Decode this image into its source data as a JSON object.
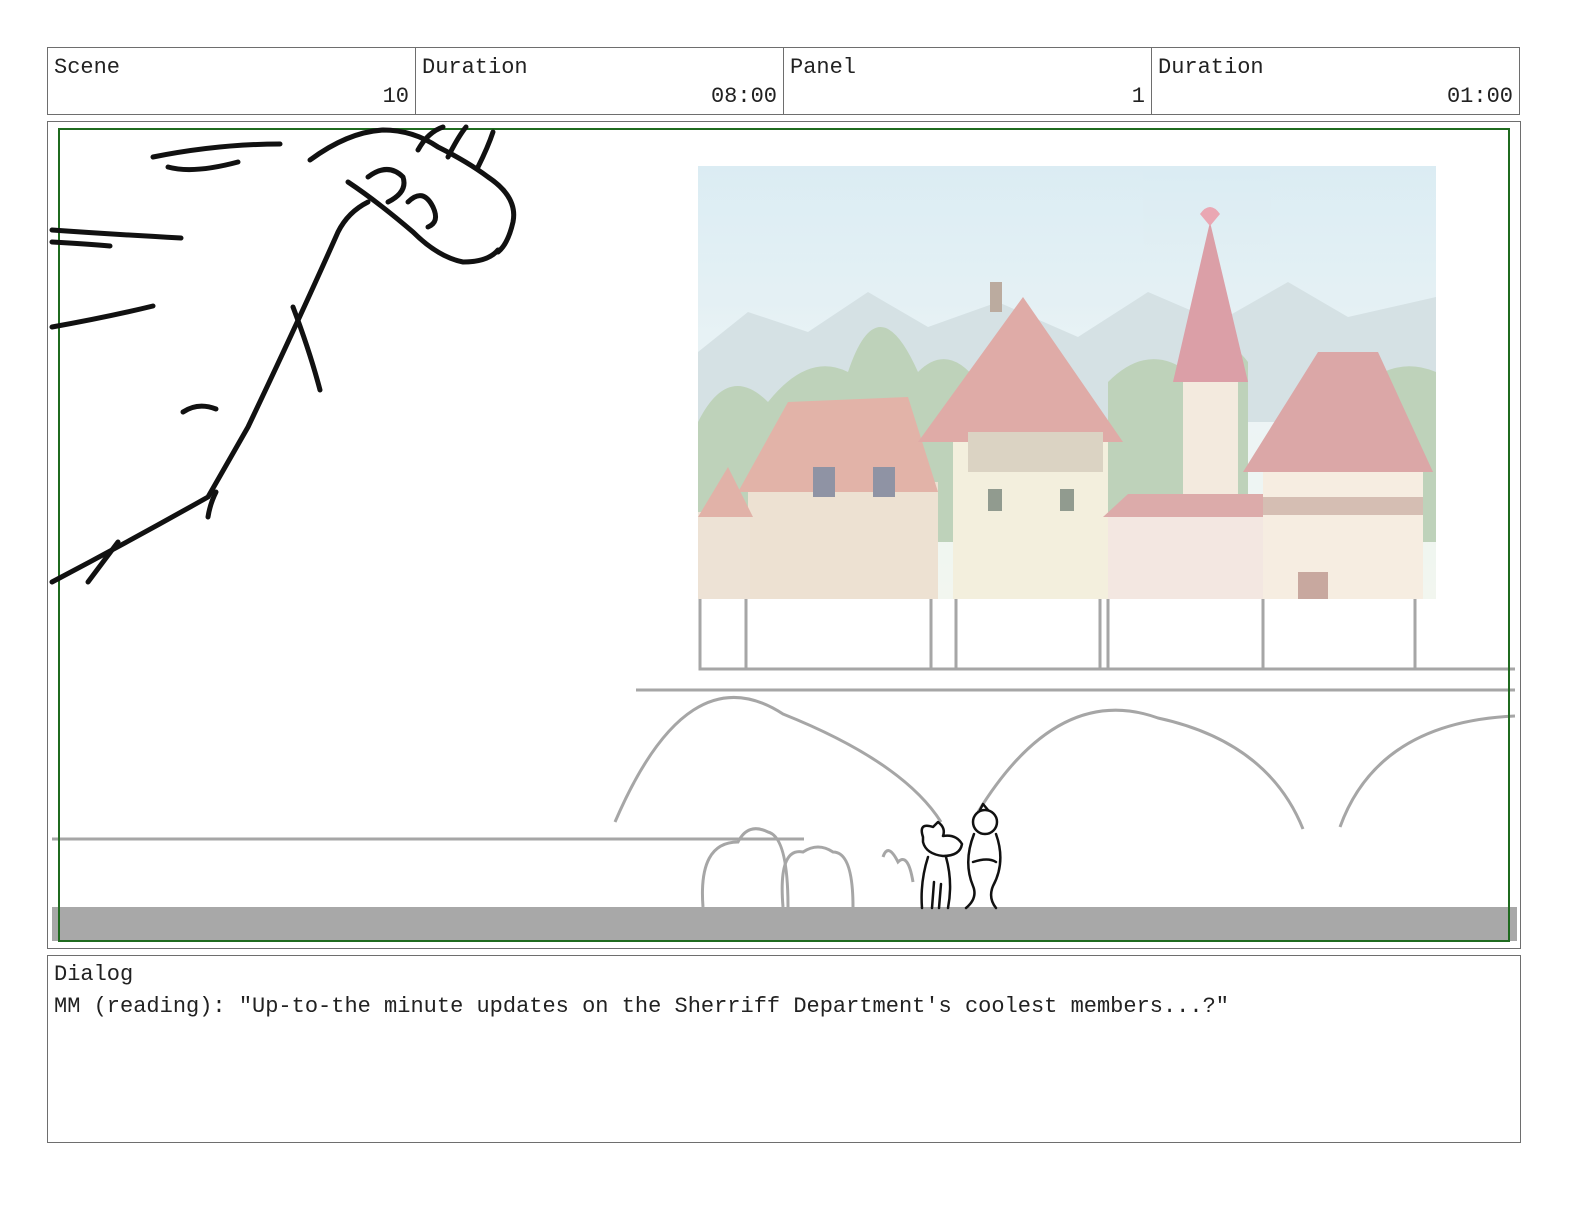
{
  "header": {
    "scene_label": "Scene",
    "scene_value": "10",
    "scene_duration_label": "Duration",
    "scene_duration_value": "08:00",
    "panel_label": "Panel",
    "panel_value": "1",
    "panel_duration_label": "Duration",
    "panel_duration_value": "01:00"
  },
  "panel": {
    "frame_color": "#1f6b1f",
    "sketch_color": "#111111",
    "layout_line_color": "#a6a6a6",
    "ground_color": "#a8a8a8"
  },
  "dialog": {
    "label": "Dialog",
    "text": "MM (reading): \"Up-to-the minute updates on the Sherriff Department's coolest members...?\""
  }
}
